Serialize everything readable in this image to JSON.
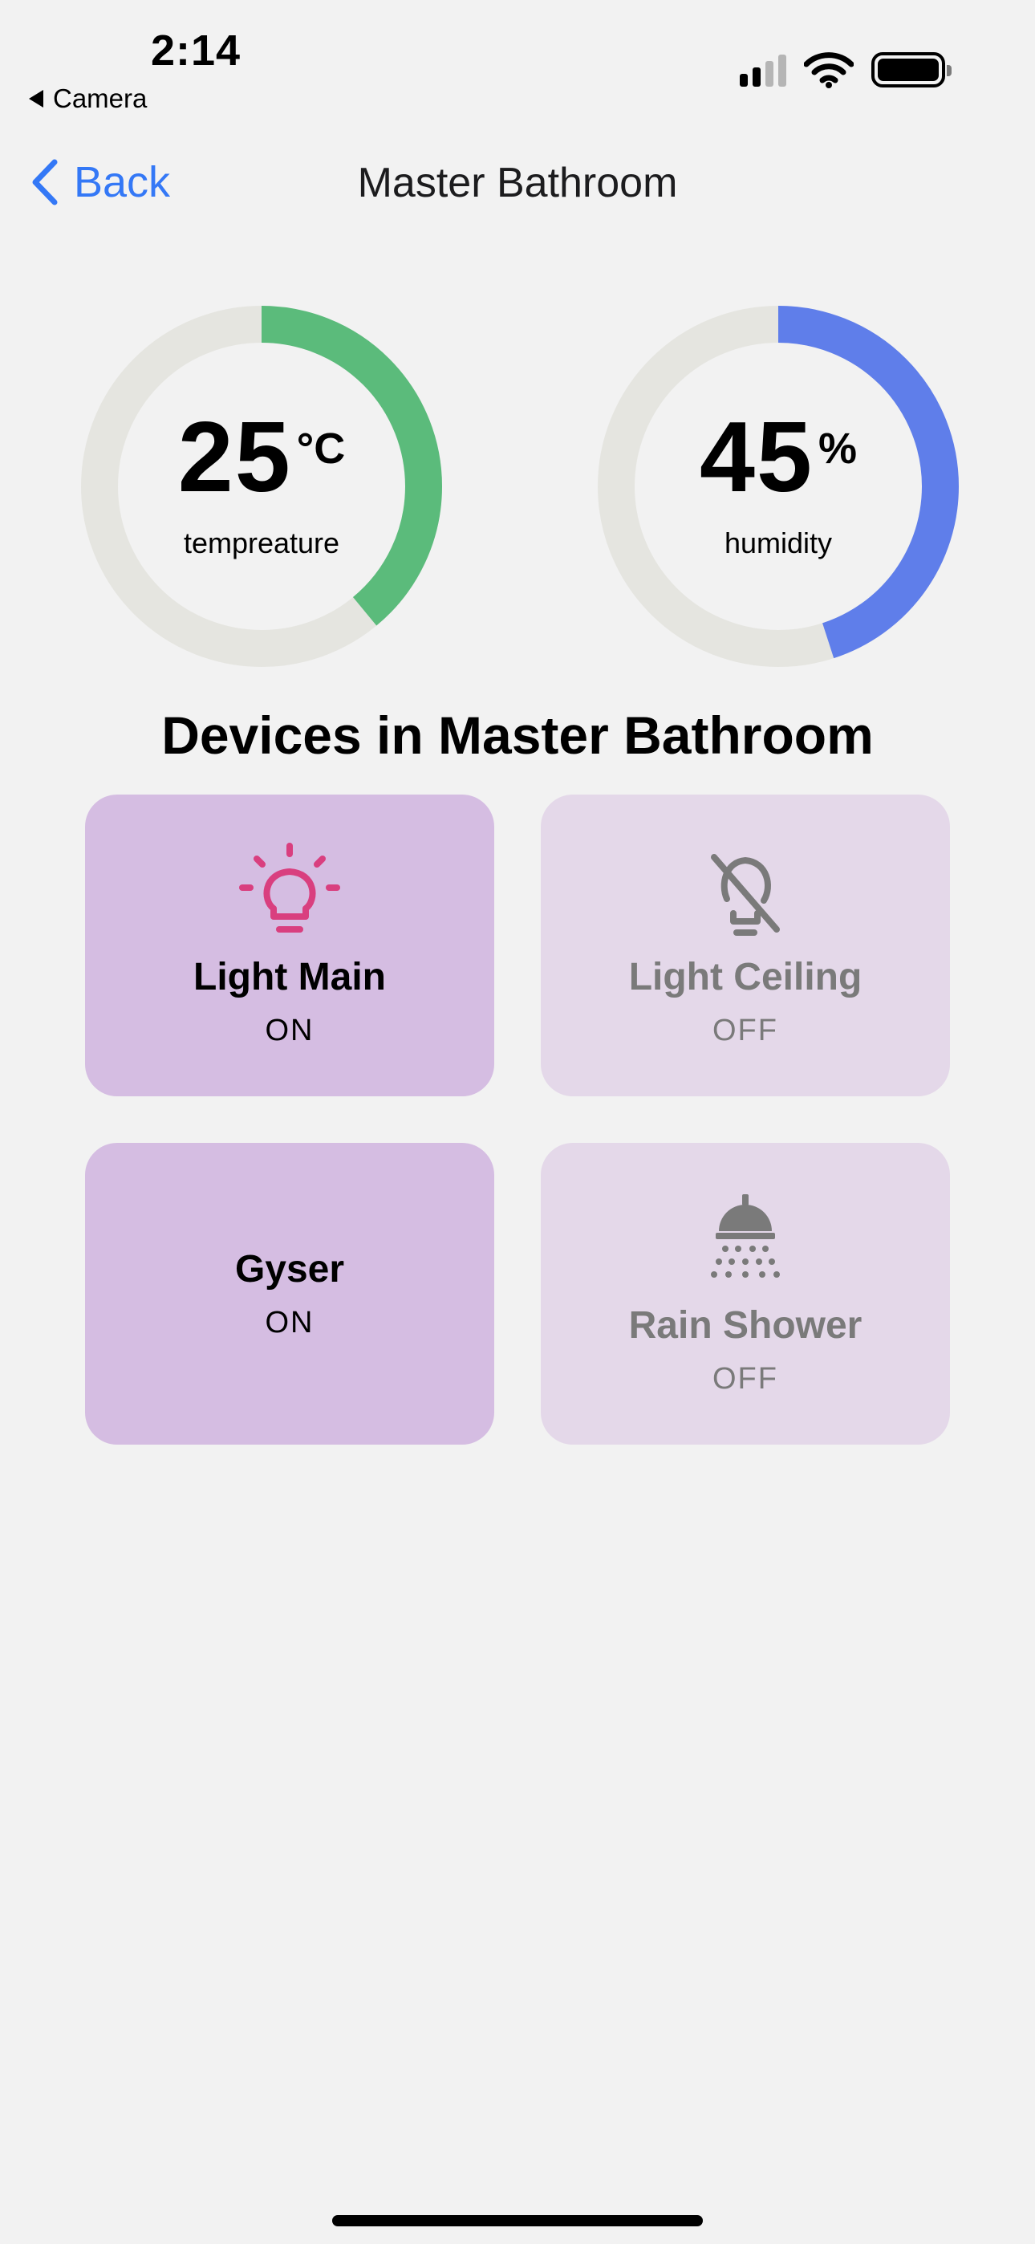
{
  "status_bar": {
    "time": "2:14",
    "back_app": "Camera"
  },
  "nav": {
    "back_label": "Back",
    "title": "Master Bathroom"
  },
  "gauges": [
    {
      "value": "25",
      "unit": "°C",
      "label": "tempreature",
      "level": 0.39,
      "color": "#5bbb7b",
      "track": "#e5e5e0"
    },
    {
      "value": "45",
      "unit": "%",
      "label": "humidity",
      "level": 0.45,
      "color": "#5f7eea",
      "track": "#e5e5e0"
    }
  ],
  "devices_title": "Devices in Master Bathroom",
  "devices": [
    {
      "name": "Light Main",
      "state": "ON",
      "icon": "lightbulb-icon",
      "on": true
    },
    {
      "name": "Light Ceiling",
      "state": "OFF",
      "icon": "lightbulb-off-icon",
      "on": false
    },
    {
      "name": "Gyser",
      "state": "ON",
      "icon": "",
      "on": true
    },
    {
      "name": "Rain Shower",
      "state": "OFF",
      "icon": "shower-icon",
      "on": false
    }
  ],
  "colors": {
    "accent": "#3478f6",
    "on_card": "#d5bde2",
    "off_card": "#e4d8e9",
    "bulb_on": "#d93f7f"
  }
}
